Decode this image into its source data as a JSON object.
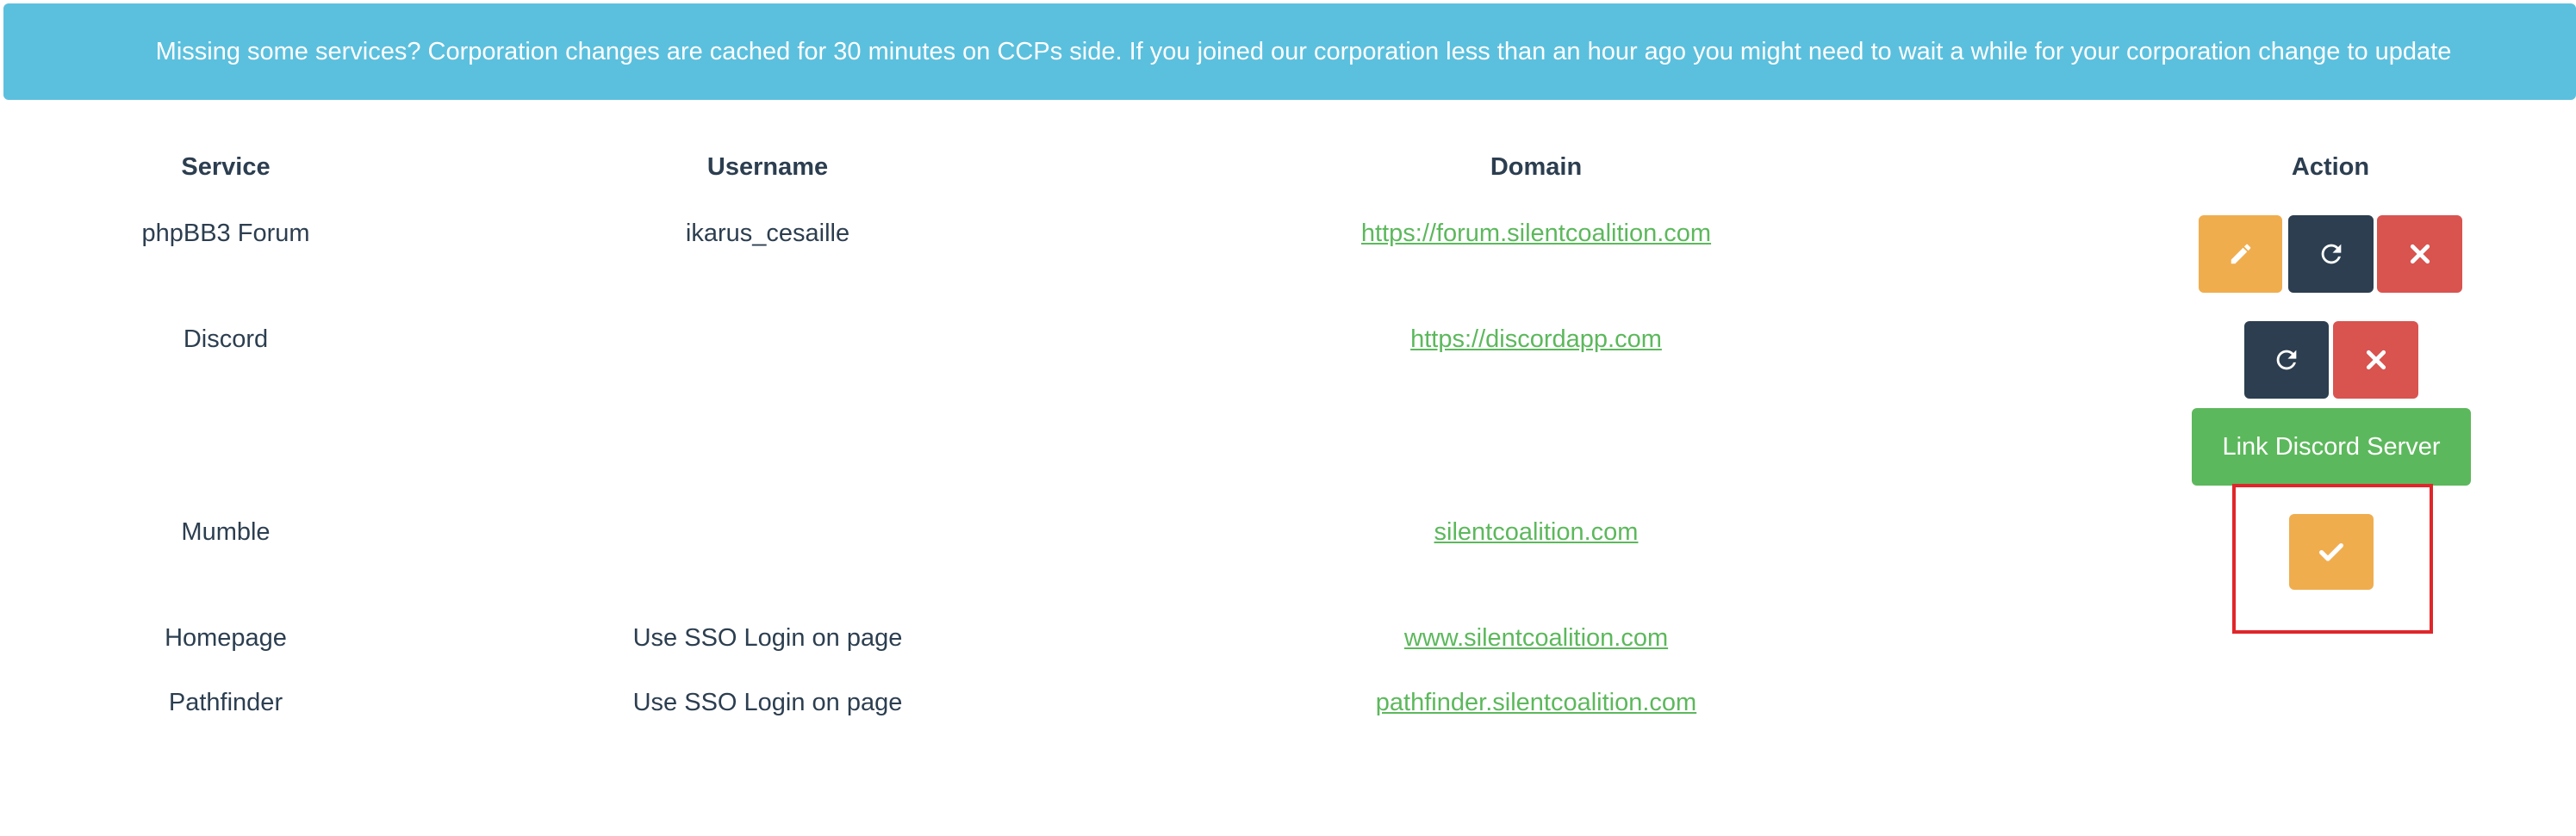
{
  "alert": {
    "message": "Missing some services? Corporation changes are cached for 30 minutes on CCPs side. If you joined our corporation less than an hour ago you might need to wait a while for your corporation change to update"
  },
  "table": {
    "headers": [
      "Service",
      "Username",
      "Domain",
      "Action"
    ],
    "rows": [
      {
        "service": "phpBB3 Forum",
        "username": "ikarus_cesaille",
        "domain": "https://forum.silentcoalition.com",
        "actions": [
          "pencil-icon",
          "refresh-icon",
          "close-icon"
        ]
      },
      {
        "service": "Discord",
        "username": "",
        "domain": "https://discordapp.com",
        "actions": [
          "refresh-icon",
          "close-icon"
        ],
        "extra_action_label": "Link Discord Server"
      },
      {
        "service": "Mumble",
        "username": "",
        "domain": "silentcoalition.com",
        "actions": [
          "check-icon"
        ]
      },
      {
        "service": "Homepage",
        "username": "Use SSO Login on page",
        "domain": "www.silentcoalition.com",
        "actions": []
      },
      {
        "service": "Pathfinder",
        "username": "Use SSO Login on page",
        "domain": "pathfinder.silentcoalition.com",
        "actions": []
      }
    ]
  },
  "colors": {
    "alert_bg": "#5bc0de",
    "link": "#5cb85c",
    "warning": "#f0ad4e",
    "primary": "#2c3e50",
    "danger": "#d9534f",
    "success": "#5cb85c",
    "highlight": "#e0262a"
  }
}
